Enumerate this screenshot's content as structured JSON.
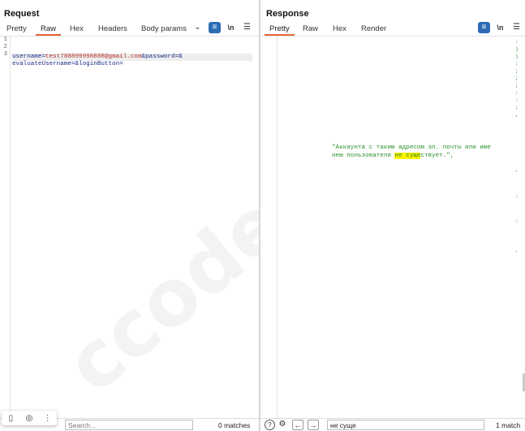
{
  "request": {
    "title": "Request",
    "tabs": [
      {
        "label": "Pretty",
        "active": false
      },
      {
        "label": "Raw",
        "active": true
      },
      {
        "label": "Hex",
        "active": false
      },
      {
        "label": "Headers",
        "active": false
      },
      {
        "label": "Body params",
        "active": false
      }
    ],
    "icons": [
      "chevron-down-icon",
      "wrap-icon",
      "newline-icon",
      "menu-icon"
    ],
    "newline_label": "\\n",
    "line_numbers": [
      "1",
      "2",
      "3"
    ],
    "body": {
      "k1": "username",
      "eq1": "=",
      "v1": "test788899998888",
      "at": "@",
      "v1b": "gmail.com",
      "amp1": "&",
      "k2": "password",
      "eq2": "=",
      "amp2": "&",
      "k3": "evaluateUsername",
      "eq3": "=",
      "amp3": "&",
      "k4": "loginButton",
      "eq4": "="
    },
    "search": {
      "placeholder": "Search...",
      "value": "",
      "matches": "0 matches"
    }
  },
  "response": {
    "title": "Response",
    "tabs": [
      {
        "label": "Pretty",
        "active": true
      },
      {
        "label": "Raw",
        "active": false
      },
      {
        "label": "Hex",
        "active": false
      },
      {
        "label": "Render",
        "active": false
      }
    ],
    "newline_label": "\\n",
    "text_line1": "\"Аккаунта с таким адресом эл. почты или име",
    "text_line2_pre": "нем пользователя ",
    "text_line2_mark": "не суще",
    "text_line2_post": "ствует.\",",
    "search": {
      "value": "не суще",
      "matches": "1 match"
    }
  },
  "watermark": "ccodebynet",
  "colors": {
    "accent_tab": "#e8663a",
    "toolbar_blue": "#2d6cb4",
    "highlight": "#fff200",
    "string_green": "#2a8f2a"
  }
}
